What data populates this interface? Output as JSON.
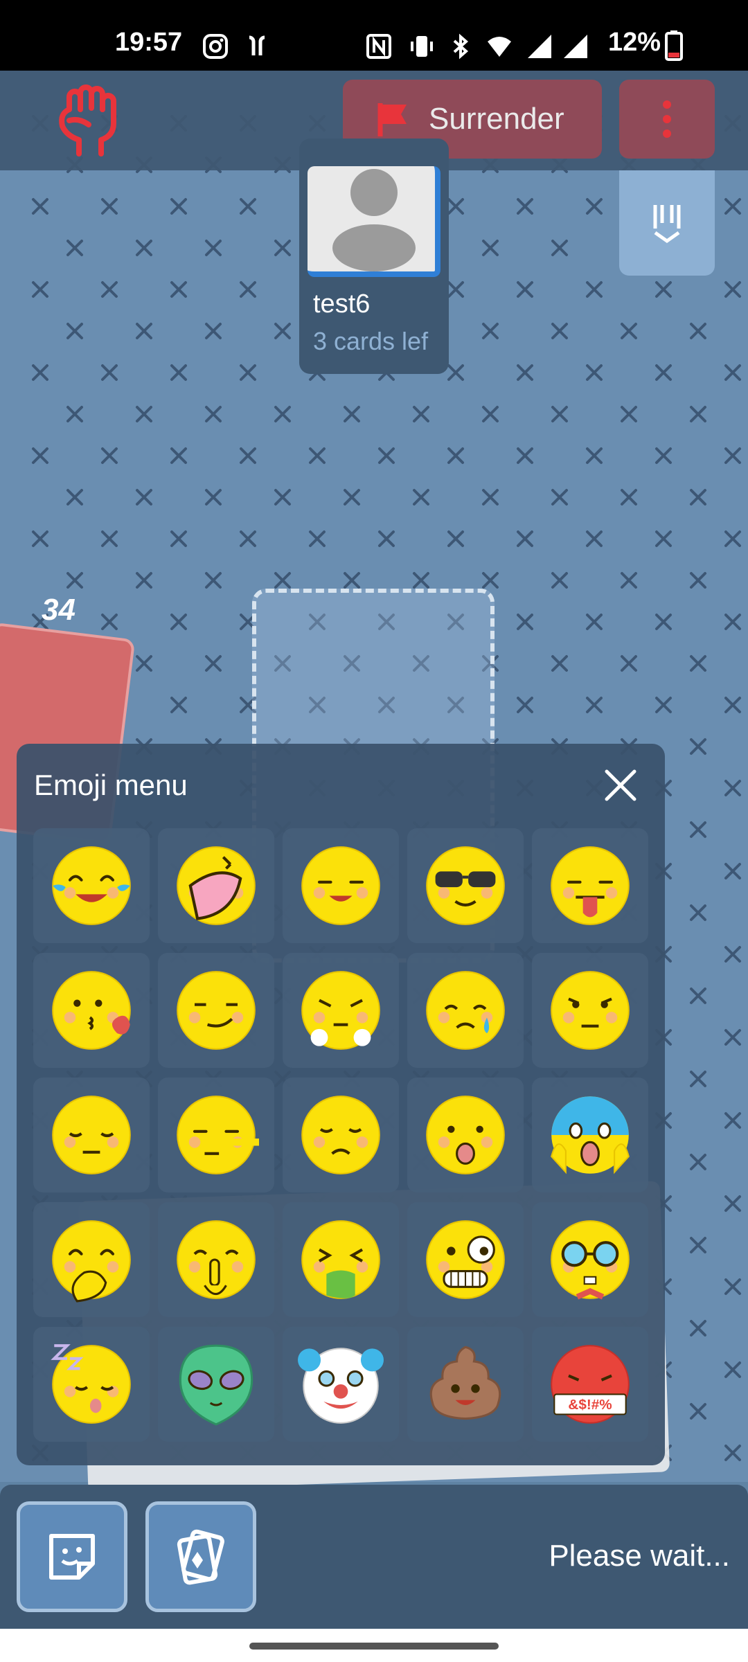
{
  "status_bar": {
    "time": "19:57",
    "battery_percent": "12%",
    "icons": [
      "instagram-icon",
      "airpods-icon",
      "nfc-icon",
      "vibrate-icon",
      "bluetooth-icon",
      "wifi-icon",
      "signal-r-icon",
      "signal-icon",
      "battery-low-icon"
    ]
  },
  "topbar": {
    "logo_icon": "raised-fist-icon",
    "surrender_label": "Surrender",
    "menu_icon": "kebab-menu-icon",
    "rank_icon": "rank-chevron-icon"
  },
  "opponent": {
    "name": "test6",
    "cards_left": "3 cards lef"
  },
  "deck": {
    "count": "34"
  },
  "emoji_menu": {
    "title": "Emoji menu",
    "close_icon": "close-icon",
    "emojis": [
      "tears-of-joy",
      "laughing",
      "smile",
      "cool-sunglasses",
      "tongue-out",
      "kiss-heart",
      "smirk",
      "triumph-steam",
      "crying",
      "suspicious",
      "disappointed",
      "lying-nose",
      "worried",
      "surprised",
      "screaming",
      "hand-over-mouth",
      "shush",
      "vomiting",
      "crazy",
      "nerd-glasses",
      "sleeping",
      "alien",
      "clown",
      "poop",
      "swearing"
    ],
    "swear_text": "&$!#%"
  },
  "bottom_bar": {
    "sticker_icon": "sticker-icon",
    "cards_icon": "cards-icon",
    "status_text": "Please wait..."
  },
  "colors": {
    "board": "#6a8eb1",
    "panel": "#3e5872",
    "surrender": "#8f4a58",
    "accent_red": "#e8343b",
    "emoji_yellow": "#fbe10a"
  }
}
